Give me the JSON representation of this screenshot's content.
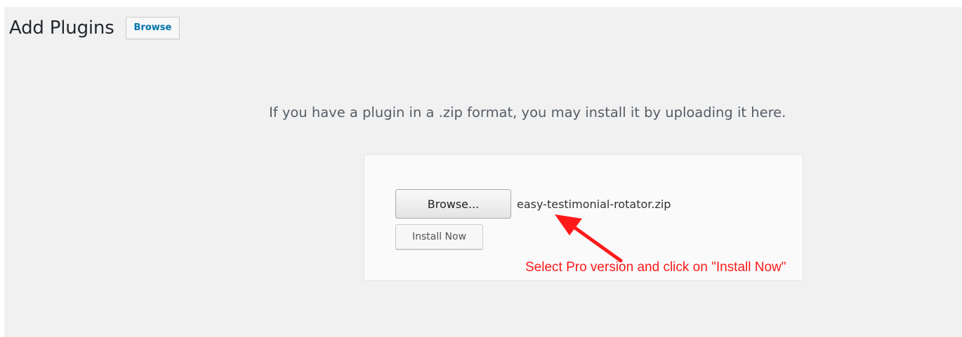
{
  "header": {
    "title": "Add Plugins",
    "browse_label": "Browse"
  },
  "upload": {
    "help_text": "If you have a plugin in a .zip format, you may install it by uploading it here.",
    "file_button_label": "Browse...",
    "file_name": "easy-testimonial-rotator.zip",
    "install_label": "Install Now"
  },
  "annotation": {
    "text": "Select Pro version and click on \"Install Now\"",
    "color": "#ff1a1a"
  },
  "colors": {
    "background": "#f1f1f1",
    "link_blue": "#0073aa",
    "annotation_red": "#ff1a1a"
  }
}
